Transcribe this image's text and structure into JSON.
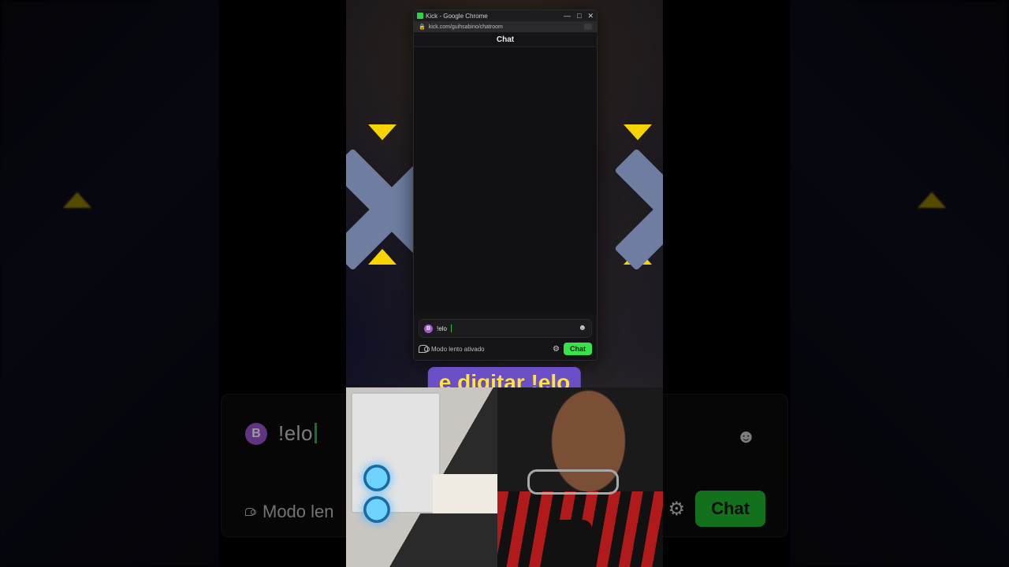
{
  "window": {
    "title": "Kick - Google Chrome",
    "controls": {
      "min": "—",
      "max": "□",
      "close": "✕"
    }
  },
  "address_bar": {
    "lock_icon": "lock",
    "url": "kick.com/guihsabino/chatroom"
  },
  "chat": {
    "header": "Chat",
    "input": {
      "badge_letter": "B",
      "value": "!elo",
      "emoji_icon": "☻"
    },
    "footer": {
      "slow_mode_text": "Modo lento ativado",
      "settings_icon": "⚙",
      "send_label": "Chat"
    }
  },
  "mirror": {
    "badge_letter": "B",
    "value": "!elo",
    "emoji_icon": "☻",
    "slow_mode_text_partial": "Modo len",
    "settings_icon": "⚙",
    "send_label": "Chat"
  },
  "caption": {
    "text": "e digitar !elo"
  },
  "colors": {
    "kick_green": "#37e24b",
    "caption_bg": "#6a4fc7",
    "caption_text": "#ffe23a"
  }
}
